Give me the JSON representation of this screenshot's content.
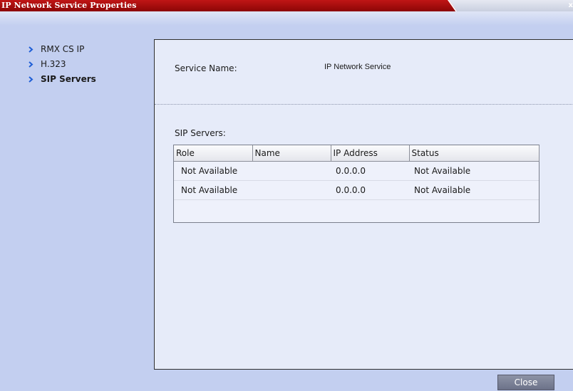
{
  "window": {
    "title": "IP Network Service Properties",
    "close_glyph": "x"
  },
  "nav": {
    "items": [
      {
        "label": "RMX CS IP",
        "icon": "chevron-right-icon",
        "active": false
      },
      {
        "label": "H.323",
        "icon": "chevron-right-icon",
        "active": false
      },
      {
        "label": "SIP Servers",
        "icon": "chevron-right-icon",
        "active": true
      }
    ]
  },
  "service": {
    "name_label": "Service Name:",
    "name_value": "IP Network Service"
  },
  "sip_servers": {
    "label": "SIP Servers:",
    "columns": [
      "Role",
      "Name",
      "IP Address",
      "Status"
    ],
    "rows": [
      {
        "role": "Not Available",
        "name": "",
        "ip": "0.0.0.0",
        "status": "Not Available"
      },
      {
        "role": "Not Available",
        "name": "",
        "ip": "0.0.0.0",
        "status": "Not Available"
      }
    ]
  },
  "footer": {
    "close_label": "Close"
  },
  "colors": {
    "title_bar": "#a60e0e",
    "background": "#c3cff0",
    "panel": "#e6ebf9",
    "chevron": "#1f5fd6",
    "button": "#7a8098"
  }
}
